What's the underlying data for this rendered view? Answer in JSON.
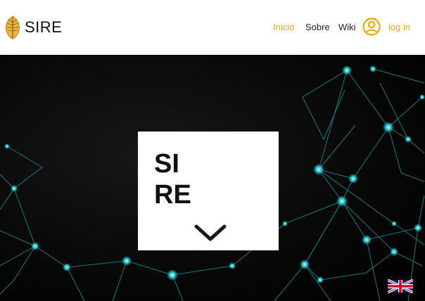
{
  "brand": {
    "name": "SIRE",
    "logo": "feather-logo"
  },
  "nav": {
    "inicio": "Inicio",
    "sobre": "Sobre",
    "wiki": "Wiki",
    "user_icon": "user-circle-icon",
    "login": "log in"
  },
  "hero": {
    "card_title": "SIRE",
    "scroll_icon": "chevron-down-icon",
    "language_flag": "uk-flag-icon"
  },
  "colors": {
    "accent": "#f0a800",
    "network": "#2bbfc4",
    "hero_bg": "#0a0a0a"
  }
}
